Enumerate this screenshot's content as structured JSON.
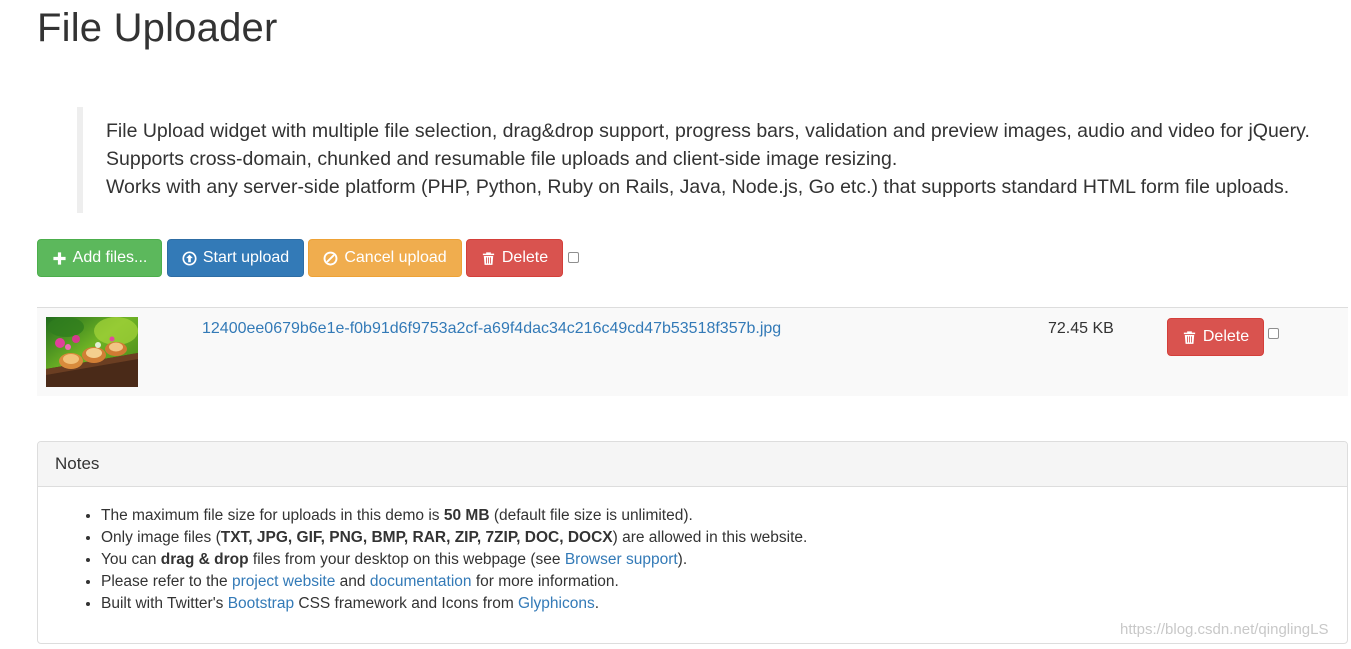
{
  "page": {
    "title": "File Uploader",
    "lead": [
      "File Upload widget with multiple file selection, drag&drop support, progress bars, validation and preview images, audio and video for jQuery.",
      "Supports cross-domain, chunked and resumable file uploads and client-side image resizing.",
      "Works with any server-side platform (PHP, Python, Ruby on Rails, Java, Node.js, Go etc.) that supports standard HTML form file uploads."
    ]
  },
  "toolbar": {
    "add_label": "Add files...",
    "start_label": "Start upload",
    "cancel_label": "Cancel upload",
    "delete_label": "Delete",
    "select_all_checked": false
  },
  "files": [
    {
      "name": "12400ee0679b6e1e-f0b91d6f9753a2cf-a69f4dac34c216c49cd47b53518f357b.jpg",
      "size": "72.45 KB",
      "delete_label": "Delete",
      "checked": false
    }
  ],
  "notes": {
    "heading": "Notes",
    "items": {
      "n1_a": "The maximum file size for uploads in this demo is ",
      "n1_b": "50 MB",
      "n1_c": " (default file size is unlimited).",
      "n2_a": "Only image files (",
      "n2_b": "TXT, JPG, GIF, PNG, BMP, RAR, ZIP, 7ZIP, DOC, DOCX",
      "n2_c": ") are allowed in this website.",
      "n3_a": "You can ",
      "n3_b": "drag & drop",
      "n3_c": " files from your desktop on this webpage (see ",
      "n3_link": "Browser support",
      "n3_d": ").",
      "n4_a": "Please refer to the ",
      "n4_link1": "project website",
      "n4_b": " and ",
      "n4_link2": "documentation",
      "n4_c": " for more information.",
      "n5_a": "Built with Twitter's ",
      "n5_link1": "Bootstrap",
      "n5_b": " CSS framework and Icons from ",
      "n5_link2": "Glyphicons",
      "n5_c": "."
    }
  },
  "watermark": "https://blog.csdn.net/qinglingLS",
  "icons": {
    "add": "plus-icon",
    "start": "circle-arrow-up-icon",
    "cancel": "ban-circle-icon",
    "delete": "trash-icon"
  },
  "colors": {
    "success": "#5cb85c",
    "primary": "#337ab7",
    "warning": "#f0ad4e",
    "danger": "#d9534f",
    "link": "#337ab7"
  }
}
